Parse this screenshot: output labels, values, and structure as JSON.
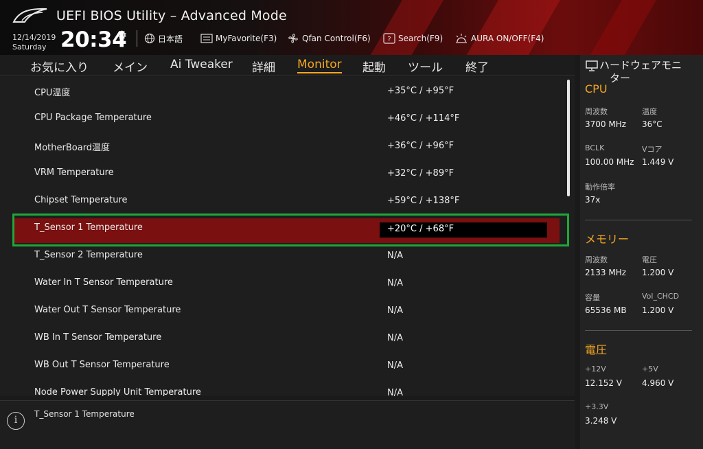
{
  "header": {
    "title": "UEFI BIOS Utility – Advanced Mode",
    "date": "12/14/2019",
    "day": "Saturday",
    "time": "20:34",
    "tools": {
      "language": "日本語",
      "myfavorite": "MyFavorite(F3)",
      "qfan": "Qfan Control(F6)",
      "search": "Search(F9)",
      "aura": "AURA ON/OFF(F4)"
    }
  },
  "tabs": [
    "お気に入り",
    "メイン",
    "Ai Tweaker",
    "詳細",
    "Monitor",
    "起動",
    "ツール",
    "終了"
  ],
  "active_tab": "Monitor",
  "rows": [
    {
      "label": "CPU温度",
      "value": "+35°C / +95°F"
    },
    {
      "label": "CPU Package Temperature",
      "value": "+46°C / +114°F"
    },
    {
      "label": "MotherBoard温度",
      "value": "+36°C / +96°F"
    },
    {
      "label": "VRM Temperature",
      "value": "+32°C / +89°F"
    },
    {
      "label": "Chipset Temperature",
      "value": "+59°C / +138°F"
    },
    {
      "label": "T_Sensor 1 Temperature",
      "value": "+20°C / +68°F"
    },
    {
      "label": "T_Sensor 2 Temperature",
      "value": "N/A"
    },
    {
      "label": "Water In T Sensor Temperature",
      "value": "N/A"
    },
    {
      "label": "Water Out T Sensor Temperature",
      "value": "N/A"
    },
    {
      "label": "WB In T Sensor Temperature",
      "value": "N/A"
    },
    {
      "label": "WB Out T Sensor Temperature",
      "value": "N/A"
    },
    {
      "label": "Node Power Supply Unit Temperature",
      "value": "N/A"
    }
  ],
  "selected_row": "T_Sensor 1 Temperature",
  "help_text": "T_Sensor 1 Temperature",
  "hw": {
    "title_line1": "ハードウェアモニ",
    "title_line2": "ター",
    "cpu": {
      "heading": "CPU",
      "freq_label": "周波数",
      "freq": "3700 MHz",
      "temp_label": "温度",
      "temp": "36°C",
      "bclk_label": "BCLK",
      "bclk": "100.00 MHz",
      "vcore_label": "Vコア",
      "vcore": "1.449 V",
      "ratio_label": "動作倍率",
      "ratio": "37x"
    },
    "memory": {
      "heading": "メモリー",
      "freq_label": "周波数",
      "freq": "2133 MHz",
      "volt_label": "電圧",
      "volt": "1.200 V",
      "cap_label": "容量",
      "cap": "65536 MB",
      "chcd_label": "Vol_CHCD",
      "chcd": "1.200 V"
    },
    "voltage": {
      "heading": "電圧",
      "v12_label": "+12V",
      "v12": "12.152 V",
      "v5_label": "+5V",
      "v5": "4.960 V",
      "v33_label": "+3.3V",
      "v33": "3.248 V"
    }
  },
  "colors": {
    "accent": "#f5a623",
    "selection": "#7a1010",
    "highlight_frame": "#1ea83a"
  }
}
